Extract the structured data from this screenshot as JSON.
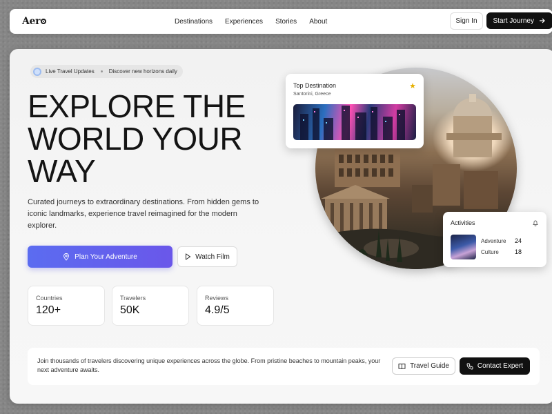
{
  "nav": {
    "logo": "Aero",
    "links": [
      "Destinations",
      "Experiences",
      "Stories",
      "About"
    ],
    "signin": "Sign In",
    "start": "Start Journey"
  },
  "hero": {
    "pill_label": "Live Travel Updates",
    "pill_text": "Discover new horizons daily",
    "headline": "EXPLORE THE WORLD YOUR WAY",
    "subtext": "Curated journeys to extraordinary destinations. From hidden gems to iconic landmarks, experience travel reimagined for the modern explorer.",
    "plan_button": "Plan Your Adventure",
    "watch_button": "Watch Film"
  },
  "stats": [
    {
      "label": "Countries",
      "value": "120+"
    },
    {
      "label": "Travelers",
      "value": "50K"
    },
    {
      "label": "Reviews",
      "value": "4.9/5"
    }
  ],
  "destination_card": {
    "title": "Top Destination",
    "subtitle": "Santorini, Greece"
  },
  "activities_card": {
    "title": "Activities",
    "rows": [
      {
        "label": "Adventure",
        "count": "24"
      },
      {
        "label": "Culture",
        "count": "18"
      }
    ]
  },
  "bottom": {
    "text": "Join thousands of travelers discovering unique experiences across the globe. From pristine beaches to mountain peaks, your next adventure awaits.",
    "guide_button": "Travel Guide",
    "contact_button": "Contact Expert"
  },
  "colors": {
    "accent": "#5b6cf0",
    "dark": "#111111",
    "star": "#e6b000"
  }
}
